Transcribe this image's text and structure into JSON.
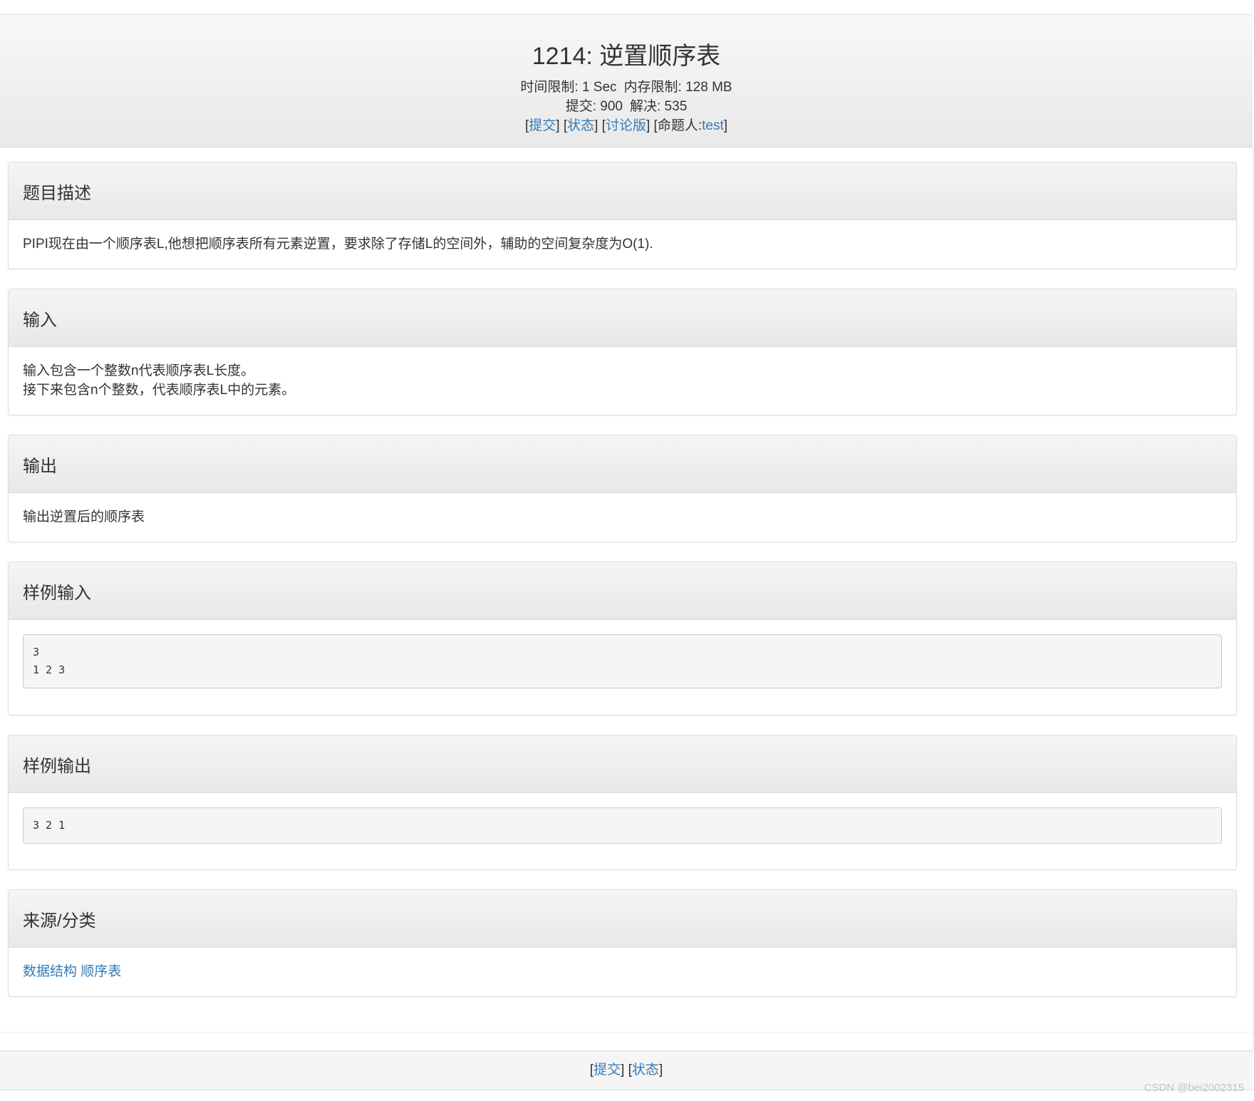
{
  "header": {
    "title": "1214: 逆置顺序表",
    "time_limit": "时间限制: 1 Sec",
    "memory_limit": "内存限制: 128 MB",
    "submit_count": "提交: 900",
    "solved_count": "解决: 535",
    "links": {
      "submit": "提交",
      "status": "状态",
      "discuss": "讨论版",
      "author_label": "命题人:",
      "author_name": "test"
    }
  },
  "sections": {
    "description": {
      "title": "题目描述",
      "text": "PIPI现在由一个顺序表L,他想把顺序表所有元素逆置，要求除了存储L的空间外，辅助的空间复杂度为O(1)."
    },
    "input": {
      "title": "输入",
      "line1": "输入包含一个整数n代表顺序表L长度。",
      "line2": "接下来包含n个整数，代表顺序表L中的元素。"
    },
    "output": {
      "title": "输出",
      "text": "输出逆置后的顺序表"
    },
    "sample_input": {
      "title": "样例输入",
      "content": "3\n1 2 3"
    },
    "sample_output": {
      "title": "样例输出",
      "content": "3 2 1"
    },
    "source": {
      "title": "来源/分类",
      "tag1": "数据结构",
      "tag2": "顺序表"
    }
  },
  "footer": {
    "submit": "提交",
    "status": "状态"
  },
  "watermark": "CSDN @bei2002315"
}
